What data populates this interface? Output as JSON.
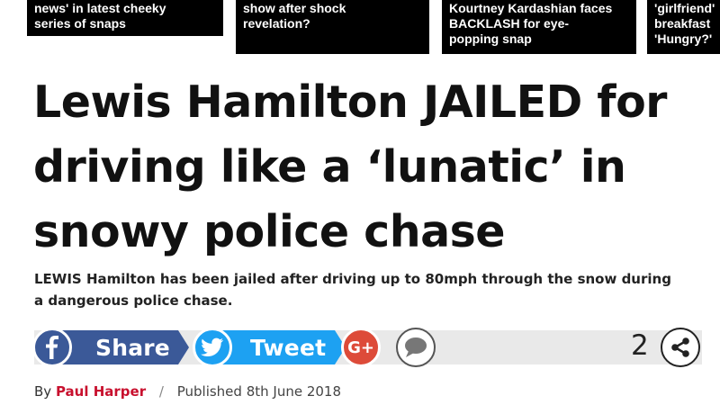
{
  "related_stories": [
    {
      "text": "news' in latest cheeky\nseries of snaps"
    },
    {
      "text": "show after shock\nrevelation?"
    },
    {
      "text": "Kourtney Kardashian faces\nBACKLASH for eye-\npopping snap"
    },
    {
      "text": "'girlfriend'\nbreakfast\n'Hungry?'"
    }
  ],
  "article": {
    "headline": "Lewis Hamilton JAILED for driving like a ‘lunatic’ in snowy police chase",
    "standfirst": "LEWIS Hamilton has been jailed after driving up to 80mph through the snow during a dangerous police chase."
  },
  "share": {
    "facebook_label": "Share",
    "facebook_icon": "facebook-icon",
    "twitter_label": "Tweet",
    "twitter_icon": "twitter-icon",
    "gplus_label": "G+",
    "comment_icon": "comment-icon",
    "count": "2",
    "more_icon": "share-icon",
    "colors": {
      "facebook": "#3b5998",
      "twitter": "#1da1f2",
      "gplus": "#dd4b39"
    }
  },
  "byline": {
    "prefix": "By",
    "author": "Paul Harper",
    "separator": "/",
    "published": "Published 8th June 2018"
  }
}
